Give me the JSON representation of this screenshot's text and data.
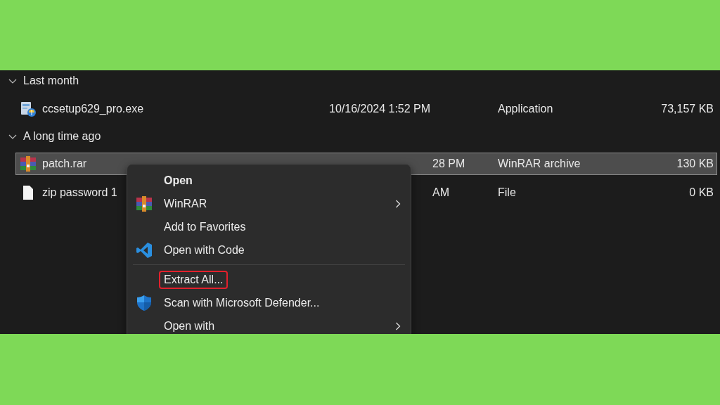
{
  "groups": [
    {
      "title": "Last month",
      "expanded": true,
      "files": [
        {
          "kind": "installer",
          "name": "ccsetup629_pro.exe",
          "date": "10/16/2024 1:52 PM",
          "date_covered": false,
          "type": "Application",
          "size": "73,157 KB",
          "selected": false
        }
      ]
    },
    {
      "title": "A long time ago",
      "expanded": true,
      "files": [
        {
          "kind": "archive",
          "name": "patch.rar",
          "date": "28 PM",
          "date_covered": true,
          "type": "WinRAR archive",
          "size": "130 KB",
          "selected": true
        },
        {
          "kind": "document",
          "name": "zip password 1",
          "date": "AM",
          "date_covered": true,
          "type": "File",
          "size": "0 KB",
          "selected": false
        }
      ]
    }
  ],
  "context_menu": {
    "items": [
      {
        "kind": "plain",
        "label": "Open",
        "bold": true,
        "submenu": false,
        "highlighted": false
      },
      {
        "kind": "archive",
        "label": "WinRAR",
        "bold": false,
        "submenu": true,
        "highlighted": false
      },
      {
        "kind": "plain",
        "label": "Add to Favorites",
        "bold": false,
        "submenu": false,
        "highlighted": false
      },
      {
        "kind": "code",
        "label": "Open with Code",
        "bold": false,
        "submenu": false,
        "highlighted": false
      },
      {
        "kind": "separator"
      },
      {
        "kind": "plain",
        "label": "Extract All...",
        "bold": false,
        "submenu": false,
        "highlighted": true
      },
      {
        "kind": "shield",
        "label": "Scan with Microsoft Defender...",
        "bold": false,
        "submenu": false,
        "highlighted": false
      },
      {
        "kind": "plain",
        "label": "Open with",
        "bold": false,
        "submenu": true,
        "highlighted": false
      }
    ]
  }
}
